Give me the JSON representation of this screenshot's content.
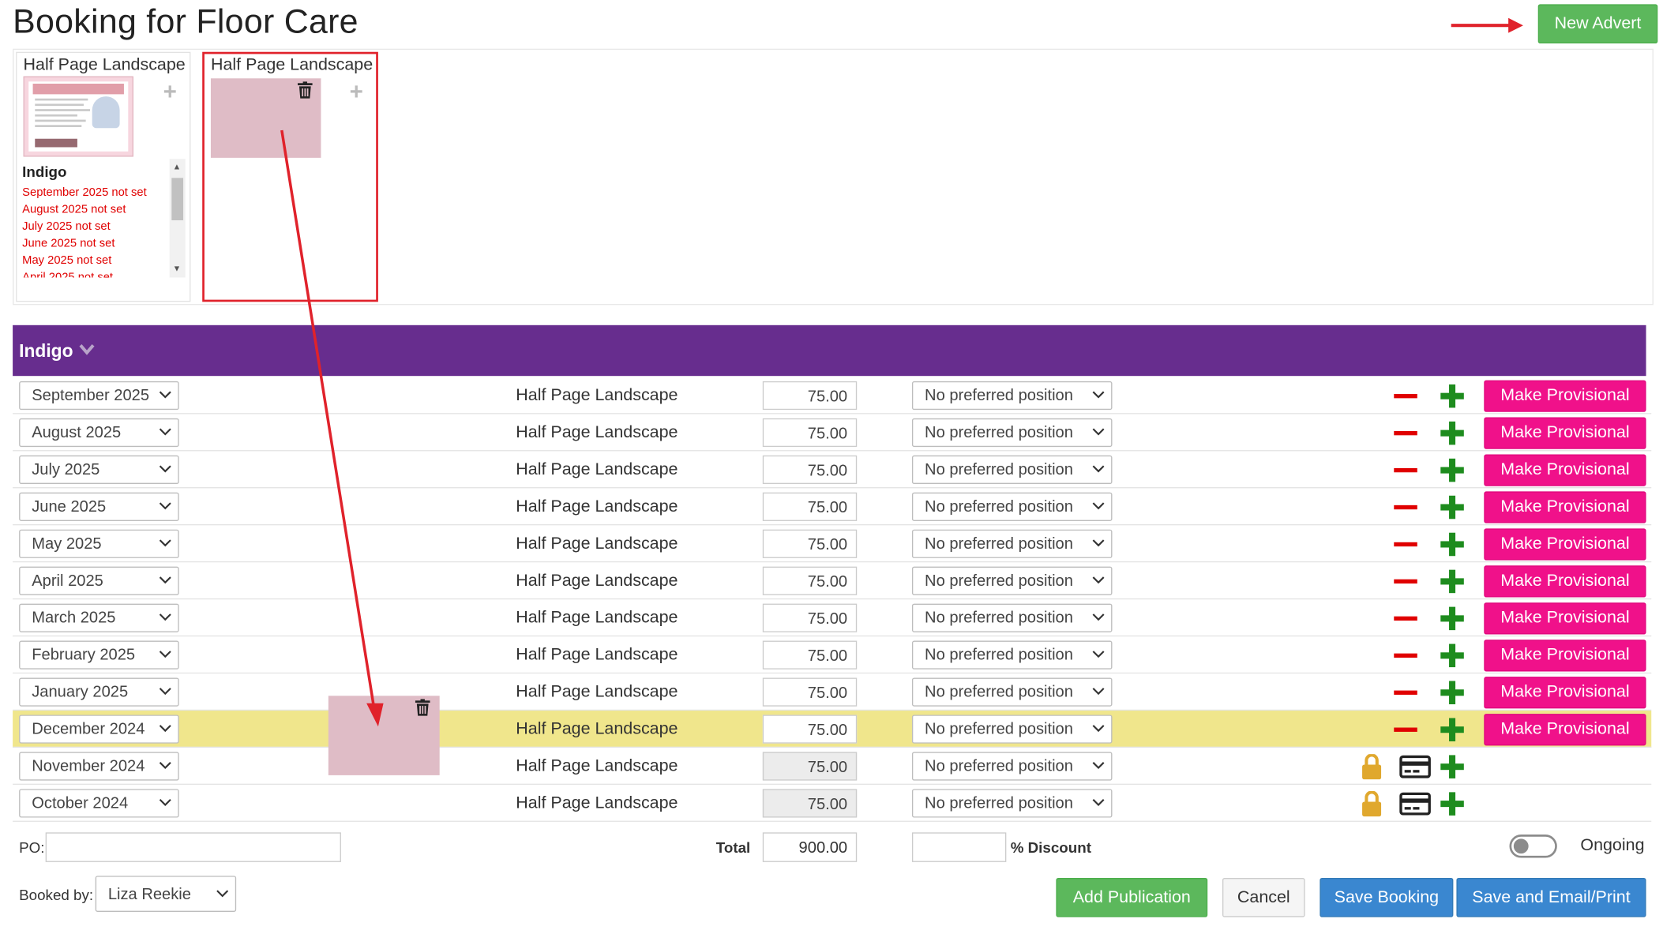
{
  "page": {
    "title": "Booking for Floor Care"
  },
  "toolbar": {
    "new_advert_label": "New Advert"
  },
  "adverts": [
    {
      "size": "Half Page Landscape",
      "publication": "Indigo",
      "thumbnail_text": "The Most Thorough Carpet and Upholstery Cleaning Ever Seen, or it's FREE!",
      "thumbnail_brand": "Floor Care",
      "dates": [
        "September 2025 not set",
        "August 2025 not set",
        "July 2025 not set",
        "June 2025 not set",
        "May 2025 not set",
        "April 2025 not set"
      ]
    },
    {
      "size": "Half Page Landscape"
    }
  ],
  "publication": {
    "name": "Indigo",
    "rows": [
      {
        "month": "September 2025",
        "size": "Half Page Landscape",
        "price": "75.00",
        "position": "No preferred position",
        "action": "Make Provisional",
        "state": "open"
      },
      {
        "month": "August 2025",
        "size": "Half Page Landscape",
        "price": "75.00",
        "position": "No preferred position",
        "action": "Make Provisional",
        "state": "open"
      },
      {
        "month": "July 2025",
        "size": "Half Page Landscape",
        "price": "75.00",
        "position": "No preferred position",
        "action": "Make Provisional",
        "state": "open"
      },
      {
        "month": "June 2025",
        "size": "Half Page Landscape",
        "price": "75.00",
        "position": "No preferred position",
        "action": "Make Provisional",
        "state": "open"
      },
      {
        "month": "May 2025",
        "size": "Half Page Landscape",
        "price": "75.00",
        "position": "No preferred position",
        "action": "Make Provisional",
        "state": "open"
      },
      {
        "month": "April 2025",
        "size": "Half Page Landscape",
        "price": "75.00",
        "position": "No preferred position",
        "action": "Make Provisional",
        "state": "open"
      },
      {
        "month": "March 2025",
        "size": "Half Page Landscape",
        "price": "75.00",
        "position": "No preferred position",
        "action": "Make Provisional",
        "state": "open"
      },
      {
        "month": "February 2025",
        "size": "Half Page Landscape",
        "price": "75.00",
        "position": "No preferred position",
        "action": "Make Provisional",
        "state": "open"
      },
      {
        "month": "January 2025",
        "size": "Half Page Landscape",
        "price": "75.00",
        "position": "No preferred position",
        "action": "Make Provisional",
        "state": "open"
      },
      {
        "month": "December 2024",
        "size": "Half Page Landscape",
        "price": "75.00",
        "position": "No preferred position",
        "action": "Make Provisional",
        "state": "highlighted"
      },
      {
        "month": "November 2024",
        "size": "Half Page Landscape",
        "price": "75.00",
        "position": "No preferred position",
        "action": "",
        "state": "locked"
      },
      {
        "month": "October 2024",
        "size": "Half Page Landscape",
        "price": "75.00",
        "position": "No preferred position",
        "action": "",
        "state": "locked"
      }
    ]
  },
  "footer": {
    "po_label": "PO:",
    "po_value": "",
    "total_label": "Total",
    "total_value": "900.00",
    "discount_value": "",
    "discount_label": "% Discount",
    "ongoing_label": "Ongoing",
    "ongoing_on": false,
    "booked_by_label": "Booked by:",
    "booked_by_value": "Liza Reekie"
  },
  "actions": {
    "add_publication": "Add Publication",
    "cancel": "Cancel",
    "save_booking": "Save Booking",
    "save_email_print": "Save and Email/Print"
  },
  "colors": {
    "publication_header": "#672d8e",
    "make_provisional": "#f0118a",
    "highlight_row": "#f0e68c",
    "annotation": "#e0222b",
    "date_not_set": "#e00000"
  }
}
